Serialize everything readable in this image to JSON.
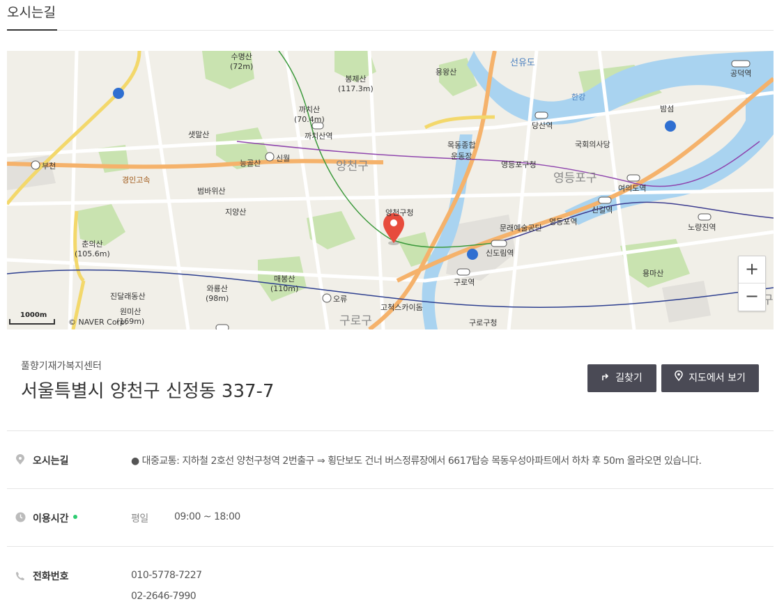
{
  "tab": {
    "label": "오시는길"
  },
  "map": {
    "scale_label": "1000m",
    "copyright": "© NAVER Corp.",
    "zoom_in": "+",
    "zoom_out": "−",
    "labels": {
      "l1": "수명산\n(72m)",
      "l2": "봉제산\n(117.3m)",
      "l3": "용왕산",
      "l4": "선유도",
      "l5": "공덕역",
      "l6": "까치산\n(70.4m)",
      "l7": "까치산역",
      "l8": "샛말산",
      "l9": "능골산",
      "l10": "신월",
      "l11": "부천",
      "l12": "경인고속",
      "l13": "양천구",
      "l14": "목동종합\n운동장",
      "l15": "영등포구청",
      "l16": "영등포구",
      "l17": "당산역",
      "l18": "국회의사당",
      "l19": "밤섬",
      "l20": "한강",
      "l21": "여의도역",
      "l22": "범바위산",
      "l23": "지양산",
      "l24": "양천구청",
      "l25": "문래예술공단",
      "l26": "영등포역",
      "l27": "신길역",
      "l28": "노량진역",
      "l29": "춘의산\n(105.6m)",
      "l30": "신도림역",
      "l31": "구로역",
      "l32": "매봉산\n(110m)",
      "l33": "와룡산\n(98m)",
      "l34": "진달래동산",
      "l35": "원미산\n(169m)",
      "l36": "오류",
      "l37": "고척스카이돔",
      "l38": "구로구",
      "l39": "구로구청",
      "l40": "용마산",
      "l41": "구"
    }
  },
  "place": {
    "category": "풀향기재가복지센터",
    "address": "서울특별시 양천구 신정동 337-7"
  },
  "buttons": {
    "directions": "길찾기",
    "view_map": "지도에서 보기"
  },
  "info": {
    "directions_title": "오시는길",
    "directions_text": "● 대중교통: 지하철 2호선 양천구청역 2번출구 ⇒ 횡단보도 건너 버스정류장에서 6617탑승 목동우성아파트에서 하차 후 50m 올라오면 있습니다.",
    "hours_title": "이용시간",
    "hours_day": "평일",
    "hours_time": "09:00 ~ 18:00",
    "phone_title": "전화번호",
    "phone1": "010-5778-7227",
    "phone2": "02-2646-7990"
  },
  "colors": {
    "river": "#a9d3f0",
    "road_major": "#f5b26b",
    "park": "#c9e3b0",
    "button_bg": "#4a4a55",
    "pin": "#e74c3c"
  }
}
